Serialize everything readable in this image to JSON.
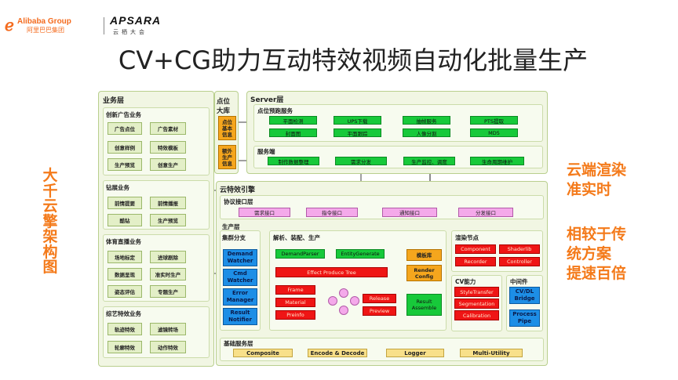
{
  "header": {
    "alibaba_logo": "Alibaba Group",
    "alibaba_logo_cn": "阿里巴巴集团",
    "apsara_logo": "APSARA",
    "apsara_logo_cn": "云栖大会",
    "title": "CV+CG助力互动特效视频自动化批量生产"
  },
  "left_note": "大千云擎架构图",
  "right_notes": {
    "note1_line1": "云端渲染",
    "note1_line2": "准实时",
    "note2_line1": "相较于传",
    "note2_line2": "统方案",
    "note2_line3": "提速百倍"
  },
  "business": {
    "title": "业务层",
    "groups": [
      {
        "title": "创新广告业务",
        "items": [
          "广告点位",
          "广告素材",
          "创意样例",
          "特效模板",
          "生产预览",
          "创意生产"
        ]
      },
      {
        "title": "钻展业务",
        "items": [
          "前情提要",
          "前情播报",
          "酷钻",
          "生产预览"
        ]
      },
      {
        "title": "体育直播业务",
        "items": [
          "场地标定",
          "进球剧除",
          "数据呈现",
          "准实时生产",
          "姿态评估",
          "专题生产"
        ]
      },
      {
        "title": "综艺特效业务",
        "items": [
          "轨迹特效",
          "滤镜转场",
          "轮廓特效",
          "动作特效"
        ]
      }
    ]
  },
  "point_db": {
    "title_line1": "点位",
    "title_line2": "大库",
    "box1": [
      "点位",
      "基本",
      "信息"
    ],
    "box2": [
      "额外",
      "生产",
      "信息"
    ]
  },
  "server": {
    "title": "Server层",
    "preprocess_title": "点位预跑服务",
    "preprocess_items": [
      "平面检测",
      "UPS下载",
      "抽帧服务",
      "PTS提取",
      "封面图",
      "平面跟踪",
      "人像分割",
      "MD5"
    ],
    "service_title": "服务端",
    "service_items": [
      "制作数据整理",
      "需求分发",
      "生产监控、调度",
      "生命周期维护"
    ]
  },
  "engine": {
    "title": "云特效引擎",
    "protocol_title": "协议接口层",
    "protocol_items": [
      "需求接口",
      "指令接口",
      "通知接口",
      "分发接口"
    ],
    "production_title": "生产层",
    "cluster_title": "集群分支",
    "cluster_items": [
      "Demand Watcher",
      "Cmd Watcher",
      "Error Manager",
      "Result Notifier"
    ],
    "parse_title": "解析、装配、生产",
    "demand_parser": "DemandParser",
    "entity_generate": "EntityGenerate",
    "template_lib": "模板库",
    "effect_tree": "Effect Produce Tree",
    "render_config": "Render Config",
    "left_nodes": [
      "Frame",
      "Material",
      "Preinfo"
    ],
    "release": "Release",
    "preview": "Preview",
    "result_assemble": "Result Assemble",
    "render_title": "渲染节点",
    "render_items": [
      "Component",
      "Shaderlib",
      "Recorder",
      "Controller"
    ],
    "cv_title": "CV能力",
    "cv_items": [
      "StyleTransfer",
      "Segmentation",
      "Calibration"
    ],
    "middleware_title": "中间件",
    "middleware_items": [
      "CV/DL Bridge",
      "Process Pipe"
    ],
    "base_title": "基础服务层",
    "base_items": [
      "Composite",
      "Encode & Decode",
      "Logger",
      "Multi-Utility"
    ]
  },
  "colors": {
    "accent_orange": "#f47a1a",
    "panel_green": "#f1f6e3",
    "node_green": "#17c93a",
    "node_red": "#ef1515",
    "node_blue": "#1d8ee6",
    "node_orange": "#f5a61d",
    "node_pink": "#f4a9ea",
    "node_yellow": "#f8e08a"
  }
}
